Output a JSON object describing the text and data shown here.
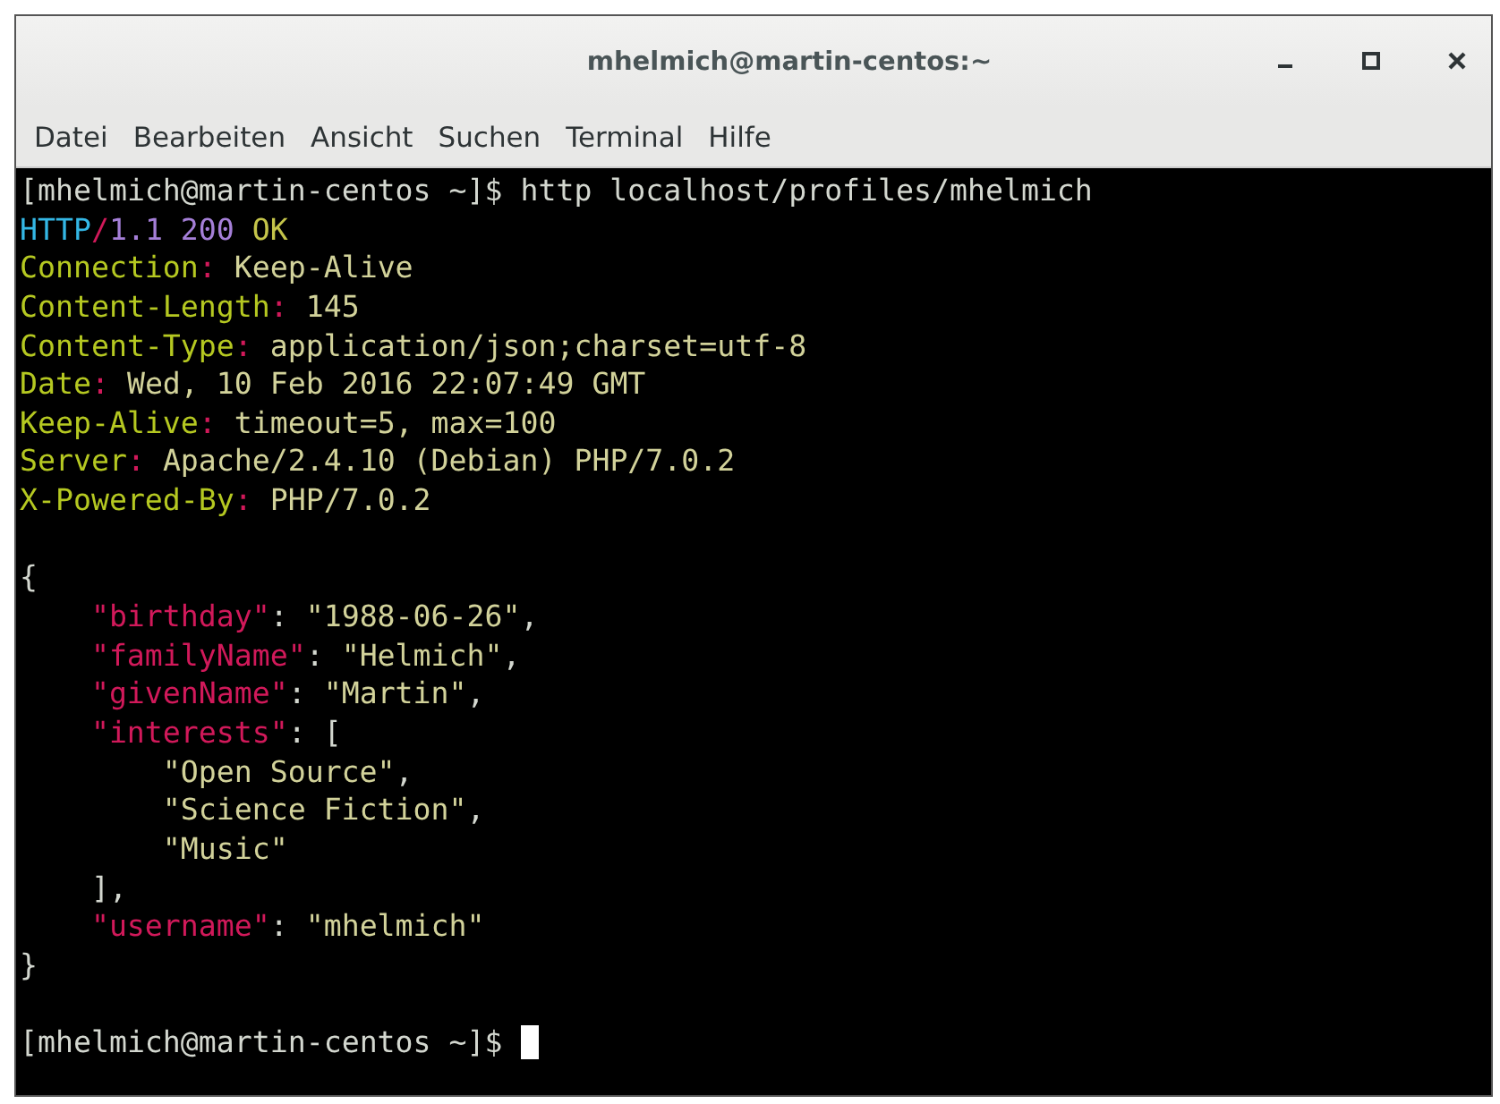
{
  "window": {
    "title": "mhelmich@martin-centos:~"
  },
  "menu": [
    "Datei",
    "Bearbeiten",
    "Ansicht",
    "Suchen",
    "Terminal",
    "Hilfe"
  ],
  "terminal": {
    "lines": [
      {
        "kind": "text",
        "segments": [
          {
            "kind": "plain",
            "text": "[mhelmich@martin-centos ~]$ http localhost/profiles/mhelmich"
          }
        ]
      },
      {
        "kind": "text",
        "segments": [
          {
            "kind": "proto",
            "text": "HTTP"
          },
          {
            "kind": "punct",
            "text": "/"
          },
          {
            "kind": "version",
            "text": "1.1 200 "
          },
          {
            "kind": "status",
            "text": "OK"
          }
        ]
      },
      {
        "kind": "text",
        "segments": [
          {
            "kind": "header",
            "text": "Connection"
          },
          {
            "kind": "punct",
            "text": ": "
          },
          {
            "kind": "value",
            "text": "Keep-Alive"
          }
        ]
      },
      {
        "kind": "text",
        "segments": [
          {
            "kind": "header",
            "text": "Content-Length"
          },
          {
            "kind": "punct",
            "text": ": "
          },
          {
            "kind": "value",
            "text": "145"
          }
        ]
      },
      {
        "kind": "text",
        "segments": [
          {
            "kind": "header",
            "text": "Content-Type"
          },
          {
            "kind": "punct",
            "text": ": "
          },
          {
            "kind": "value",
            "text": "application/json;charset=utf-8"
          }
        ]
      },
      {
        "kind": "text",
        "segments": [
          {
            "kind": "header",
            "text": "Date"
          },
          {
            "kind": "punct",
            "text": ": "
          },
          {
            "kind": "value",
            "text": "Wed, 10 Feb 2016 22:07:49 GMT"
          }
        ]
      },
      {
        "kind": "text",
        "segments": [
          {
            "kind": "header",
            "text": "Keep-Alive"
          },
          {
            "kind": "punct",
            "text": ": "
          },
          {
            "kind": "value",
            "text": "timeout=5, max=100"
          }
        ]
      },
      {
        "kind": "text",
        "segments": [
          {
            "kind": "header",
            "text": "Server"
          },
          {
            "kind": "punct",
            "text": ": "
          },
          {
            "kind": "value",
            "text": "Apache/2.4.10 (Debian) PHP/7.0.2"
          }
        ]
      },
      {
        "kind": "text",
        "segments": [
          {
            "kind": "header",
            "text": "X-Powered-By"
          },
          {
            "kind": "punct",
            "text": ": "
          },
          {
            "kind": "value",
            "text": "PHP/7.0.2"
          }
        ]
      },
      {
        "kind": "blank"
      },
      {
        "kind": "text",
        "segments": [
          {
            "kind": "plain",
            "text": "{"
          }
        ],
        "children": [
          {
            "segments": [
              {
                "kind": "json-key",
                "text": "\"birthday\""
              },
              {
                "kind": "plain",
                "text": ": "
              },
              {
                "kind": "value",
                "text": "\"1988-06-26\""
              },
              {
                "kind": "plain",
                "text": ","
              }
            ]
          },
          {
            "segments": [
              {
                "kind": "json-key",
                "text": "\"familyName\""
              },
              {
                "kind": "plain",
                "text": ": "
              },
              {
                "kind": "value",
                "text": "\"Helmich\""
              },
              {
                "kind": "plain",
                "text": ","
              }
            ]
          },
          {
            "segments": [
              {
                "kind": "json-key",
                "text": "\"givenName\""
              },
              {
                "kind": "plain",
                "text": ": "
              },
              {
                "kind": "value",
                "text": "\"Martin\""
              },
              {
                "kind": "plain",
                "text": ","
              }
            ]
          },
          {
            "segments": [
              {
                "kind": "json-key",
                "text": "\"interests\""
              },
              {
                "kind": "plain",
                "text": ": ["
              }
            ],
            "children": [
              {
                "segments": [
                  {
                    "kind": "value",
                    "text": "\"Open Source\""
                  },
                  {
                    "kind": "plain",
                    "text": ","
                  }
                ]
              },
              {
                "segments": [
                  {
                    "kind": "value",
                    "text": "\"Science Fiction\""
                  },
                  {
                    "kind": "plain",
                    "text": ","
                  }
                ]
              },
              {
                "segments": [
                  {
                    "kind": "value",
                    "text": "\"Music\""
                  }
                ]
              }
            ]
          },
          {
            "segments": [
              {
                "kind": "plain",
                "text": "],"
              }
            ]
          },
          {
            "segments": [
              {
                "kind": "json-key",
                "text": "\"username\""
              },
              {
                "kind": "plain",
                "text": ": "
              },
              {
                "kind": "value",
                "text": "\"mhelmich\""
              }
            ]
          }
        ]
      },
      {
        "kind": "text",
        "segments": [
          {
            "kind": "plain",
            "text": "}"
          }
        ]
      },
      {
        "kind": "blank"
      },
      {
        "kind": "prompt",
        "segments": [
          {
            "kind": "plain",
            "text": "[mhelmich@martin-centos ~]$ "
          }
        ]
      }
    ]
  }
}
